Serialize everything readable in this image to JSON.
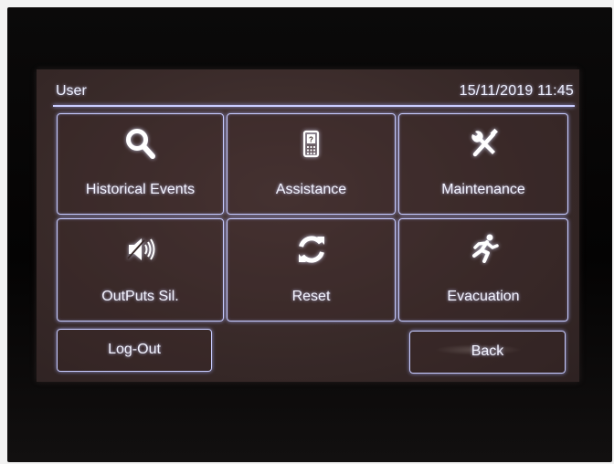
{
  "header": {
    "user_label": "User",
    "datetime": "15/11/2019 11:45"
  },
  "tiles": [
    {
      "label": "Historical Events",
      "icon": "magnifier-icon"
    },
    {
      "label": "Assistance",
      "icon": "mobile-phone-icon"
    },
    {
      "label": "Maintenance",
      "icon": "tools-icon"
    },
    {
      "label": "OutPuts Sil.",
      "icon": "speaker-muted-icon"
    },
    {
      "label": "Reset",
      "icon": "refresh-icon"
    },
    {
      "label": "Evacuation",
      "icon": "running-person-icon"
    }
  ],
  "footer": {
    "logout_label": "Log-Out",
    "back_label": "Back"
  },
  "colors": {
    "glow": "#c8ccff",
    "screen_bg": "#392a29",
    "bezel": "#050404"
  }
}
